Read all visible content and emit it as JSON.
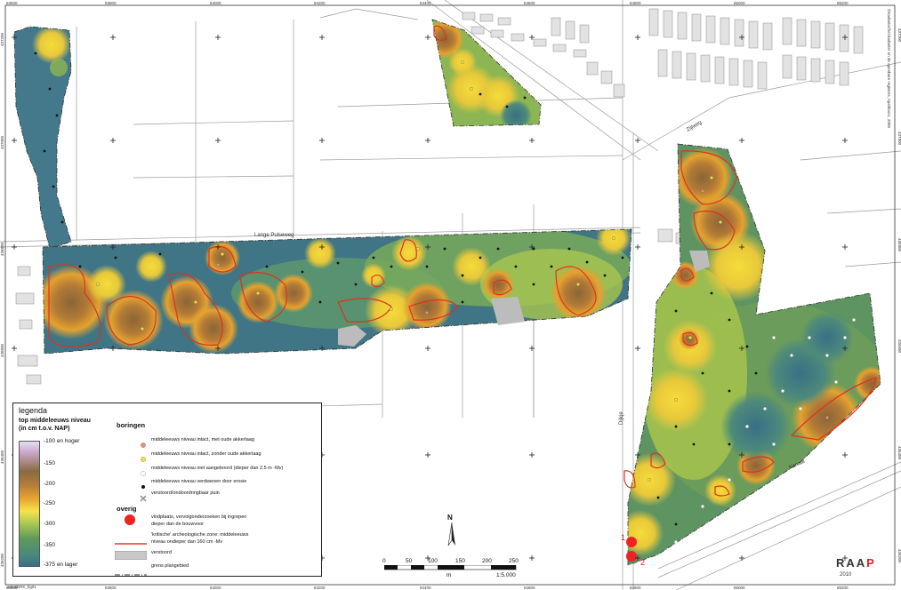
{
  "grid": {
    "x_labels": [
      "83600",
      "83800",
      "84000",
      "84200",
      "84400",
      "84600",
      "84800",
      "85000",
      "85200"
    ],
    "y_labels": [
      "437200",
      "437000",
      "436800",
      "436600",
      "436400",
      "436200"
    ]
  },
  "map_labels": {
    "street_1": "Lange Pulseweg",
    "street_2": "Zijlweg",
    "street_3": "Dijkje",
    "street_4": "Kanaal",
    "copyright": "©Kadaster/het kadaster en de openbare registers, Apeldoorn, 2009",
    "filename": "1053/ERK_fig01",
    "callout_1": "1",
    "callout_2": "2"
  },
  "legend": {
    "title": "legenda",
    "subtitle_1": "top middeleeuws niveau",
    "subtitle_2": "(in cm t.o.v. NAP)",
    "ramp_ticks": [
      "-100 en hoger",
      "-150",
      "-200",
      "-250",
      "-300",
      "-350",
      "-375 en lager"
    ],
    "borings_heading": "boringen",
    "borings": [
      {
        "label": "middeleeuws niveau intact, met oude akkerlaag",
        "color": "#e88f7c"
      },
      {
        "label": "middeleeuws niveau intact, zonder oude akkerlaag",
        "color": "#f0e43c"
      },
      {
        "label": "middeleeuws niveau niet aangeboord (dieper dan 2,5 m -Mv)",
        "color": "#ffffff"
      },
      {
        "label": "middeleeuws niveau verdwenen door erosie",
        "color": "#111111"
      },
      {
        "label": "verstoord/ondoordringbaar puin",
        "color": "#888888"
      }
    ],
    "overig_heading": "overig",
    "overig": [
      {
        "label_1": "vindplaats, vervolgonderzoeken bij ingrepen",
        "label_2": "dieper dan de bouwvoor",
        "color": "#ee2222"
      },
      {
        "label_1": "'kritische' archeologische zone: middeleeuws",
        "label_2": "niveau ondieper dan 160 cm -Mv",
        "color": "#e53a1a"
      },
      {
        "label_1": "verstoord",
        "color": "#c8c8c8"
      },
      {
        "label_1": "grens plangebied",
        "color": "#333333"
      }
    ]
  },
  "north": {
    "label": "N"
  },
  "scale": {
    "ticks": [
      "0",
      "50",
      "100",
      "150",
      "200",
      "250"
    ],
    "unit": "m",
    "ratio": "1:5.000"
  },
  "logo": {
    "letters": [
      "R",
      "A",
      "A",
      "P"
    ],
    "year": "2010"
  },
  "colors": {
    "deep": "#3e7384",
    "mid": "#98bd4e",
    "yellow": "#f4d53a",
    "orange": "#e4972f",
    "brown": "#8b6537",
    "critical": "#e0321d"
  }
}
